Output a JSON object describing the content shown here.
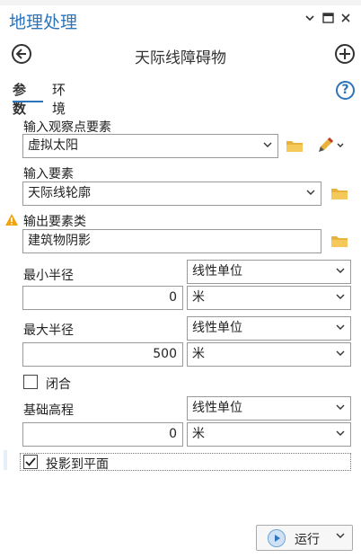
{
  "pane": {
    "title": "地理处理"
  },
  "tool": {
    "title": "天际线障碍物"
  },
  "tabs": [
    {
      "label": "参数"
    },
    {
      "label": "环境"
    }
  ],
  "params": {
    "observer": {
      "label": "输入观察点要素",
      "value": "虚拟太阳"
    },
    "features": {
      "label": "输入要素",
      "value": "天际线轮廓"
    },
    "output": {
      "label": "输出要素类",
      "value": "建筑物阴影"
    },
    "min_radius": {
      "label": "最小半径",
      "unit_type": "线性单位",
      "value": "0",
      "unit": "米"
    },
    "max_radius": {
      "label": "最大半径",
      "unit_type": "线性单位",
      "value": "500",
      "unit": "米"
    },
    "closed": {
      "label": "闭合",
      "checked": false
    },
    "base_elevation": {
      "label": "基础高程",
      "unit_type": "线性单位",
      "value": "0",
      "unit": "米"
    },
    "project_to_plane": {
      "label": "投影到平面",
      "checked": true
    }
  },
  "run": {
    "label": "运行"
  },
  "colors": {
    "accent": "#2d74b8",
    "folder": "#e8b33a",
    "warning": "#f0a30a"
  }
}
